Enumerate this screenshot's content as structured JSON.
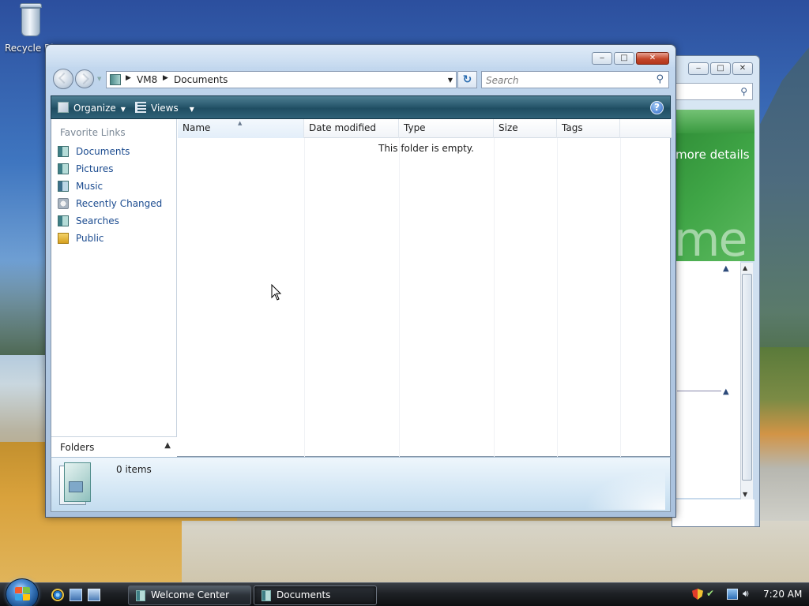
{
  "desktop": {
    "recycle_bin_label": "Recycle Bin"
  },
  "back_window": {
    "title_buttons": [
      "minimize",
      "maximize",
      "close"
    ],
    "more_details_text": "more details",
    "banner_fragment": "me"
  },
  "window": {
    "title_buttons": [
      "minimize",
      "maximize",
      "close"
    ],
    "address": {
      "crumbs": [
        "VM8",
        "Documents"
      ]
    },
    "search": {
      "placeholder": "Search"
    },
    "toolbar": {
      "organize_label": "Organize",
      "views_label": "Views",
      "help_label": "?"
    },
    "nav_pane": {
      "section_title": "Favorite Links",
      "links": [
        {
          "label": "Documents",
          "icon": "documents-icon"
        },
        {
          "label": "Pictures",
          "icon": "pictures-icon"
        },
        {
          "label": "Music",
          "icon": "music-icon"
        },
        {
          "label": "Recently Changed",
          "icon": "recently-changed-icon"
        },
        {
          "label": "Searches",
          "icon": "searches-icon"
        },
        {
          "label": "Public",
          "icon": "public-folder-icon"
        }
      ],
      "folders_label": "Folders"
    },
    "columns": [
      "Name",
      "Date modified",
      "Type",
      "Size",
      "Tags"
    ],
    "empty_message": "This folder is empty.",
    "details": {
      "item_count": "0 items"
    }
  },
  "taskbar": {
    "tasks": [
      {
        "label": "Welcome Center",
        "active": false
      },
      {
        "label": "Documents",
        "active": true
      }
    ],
    "clock": "7:20 AM"
  },
  "colors": {
    "toolbar": "#29596e",
    "link": "#1b4b8f",
    "close_button": "#c4472b"
  }
}
